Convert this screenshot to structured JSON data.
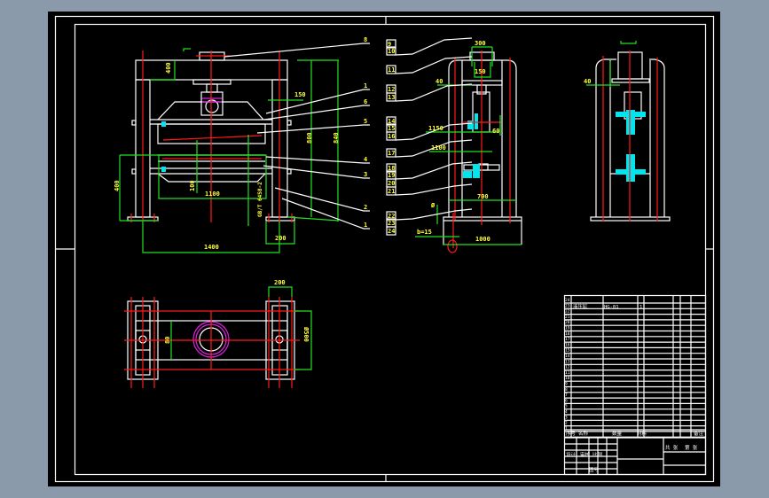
{
  "front_view": {
    "part_labels": [
      "8",
      "1",
      "6",
      "5",
      "4",
      "3",
      "2",
      "1"
    ],
    "dims": {
      "top_gap": "400",
      "crosshead": "150",
      "inner_h": "800",
      "outer_h": "840",
      "left_h": "400",
      "bolt": "100",
      "platen_w": "1100",
      "base_w": "1400",
      "foot": "200",
      "standard": "GB/T 6458-2"
    }
  },
  "side_view": {
    "part_labels": [
      "9",
      "10",
      "11",
      "12",
      "13",
      "14",
      "15",
      "16",
      "17",
      "18",
      "19",
      "20",
      "21",
      "22",
      "23",
      "24"
    ],
    "dims": {
      "top_w": "300",
      "top_h": "150",
      "offset": "40",
      "h1": "1150",
      "h2": "1100",
      "inner_w": "700",
      "base_w": "1000",
      "dia": "Ø",
      "thread": "b=15",
      "v": "60"
    }
  },
  "plan_view": {
    "dims": {
      "foot_w": "200",
      "depth": "Ø500",
      "bar": "80"
    }
  },
  "title_block": {
    "row_numbers": [
      "24",
      "23",
      "22",
      "21",
      "20",
      "19",
      "18",
      "17",
      "16",
      "15",
      "14",
      "13",
      "12",
      "11",
      "10",
      "9",
      "8",
      "7",
      "6",
      "5",
      "4",
      "3",
      "2",
      "1"
    ],
    "header": [
      "序号",
      "名称",
      "数量",
      "材料",
      "备注"
    ],
    "row_text": {
      "name": "液压缸",
      "code": "HG-01",
      "qty": "1"
    },
    "bottom": [
      "设计",
      "审核",
      "比例",
      "图号",
      "共 张",
      "第 张"
    ]
  },
  "colors": {
    "background": "#8b9aab",
    "paper": "#000000",
    "line": "#ffffff",
    "center": "#ff1a1a",
    "dim": "#22e022",
    "text": "#ffff33",
    "hatch": "#00e5ee"
  }
}
